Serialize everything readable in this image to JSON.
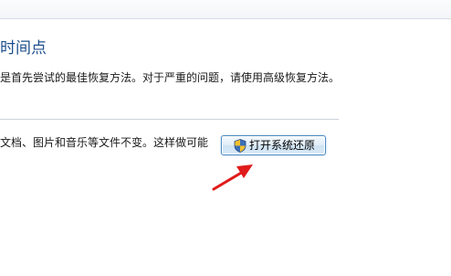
{
  "header": {
    "title": "时间点"
  },
  "body": {
    "description": "是首先尝试的最佳恢复方法。对于严重的问题，请使用高级恢复方法。",
    "note": "文档、图片和音乐等文件不变。这样做可能"
  },
  "actions": {
    "open_system_restore_label": "打开系统还原",
    "shield_icon": "uac-shield-icon"
  },
  "annotation": {
    "arrow_color": "#e01b1b"
  }
}
